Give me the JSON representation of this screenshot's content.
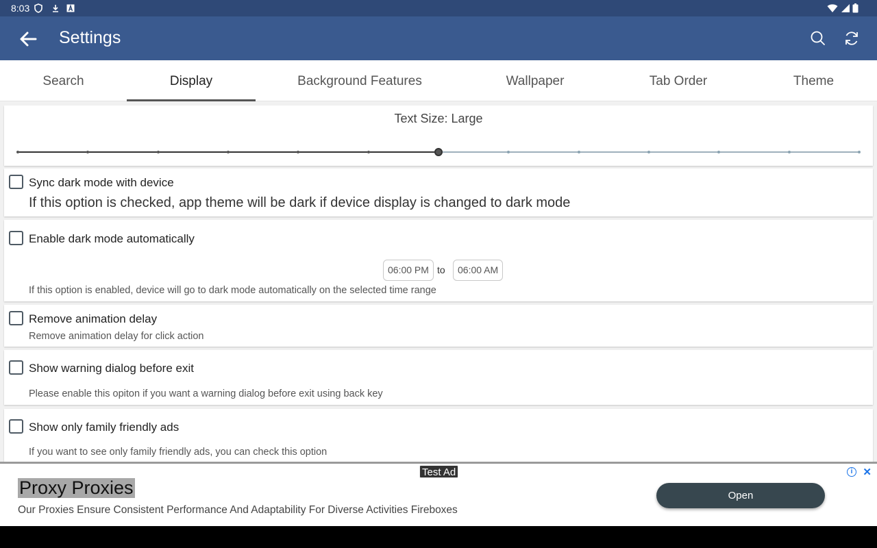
{
  "status_bar": {
    "time": "8:03",
    "icons": [
      "shield-icon",
      "download-icon",
      "a-box-icon",
      "wifi-icon",
      "signal-icon",
      "battery-icon"
    ]
  },
  "app_bar": {
    "title": "Settings",
    "actions": [
      "search-icon",
      "refresh-icon"
    ]
  },
  "tabs": [
    {
      "label": "Search"
    },
    {
      "label": "Display",
      "active": true
    },
    {
      "label": "Background Features"
    },
    {
      "label": "Wallpaper"
    },
    {
      "label": "Tab Order"
    },
    {
      "label": "Theme"
    }
  ],
  "text_size": {
    "label": "Text Size: Large",
    "steps": 13,
    "selected_step": 7
  },
  "options": {
    "sync_dark": {
      "title": "Sync dark mode with device",
      "description": "If this option is checked, app theme will be dark if device display is changed to dark mode",
      "checked": false
    },
    "auto_dark": {
      "title": "Enable dark mode automatically",
      "start_time": "06:00 PM",
      "separator": "to",
      "end_time": "06:00 AM",
      "description": "If this option is enabled, device will go to dark mode automatically on the selected time range",
      "checked": false
    },
    "remove_anim": {
      "title": "Remove animation delay",
      "description": "Remove animation delay for click action",
      "checked": false
    },
    "warn_exit": {
      "title": "Show warning dialog before exit",
      "description": "Please enable this opiton if you want a warning dialog before exit using back key",
      "checked": false
    },
    "family_ads": {
      "title": "Show only family friendly ads",
      "description": "If you want to see only family friendly ads, you can check this option",
      "checked": false
    }
  },
  "ad": {
    "badge": "Test Ad",
    "headline": "Proxy Proxies",
    "body": "Our Proxies Ensure Consistent Performance And Adaptability For Diverse Activities Fireboxes",
    "cta": "Open",
    "info_glyph": "i",
    "close_glyph": "✕"
  },
  "colors": {
    "app_bar": "#3a5a8f",
    "status_bar": "#2f4977",
    "ad_button": "#37474f"
  }
}
